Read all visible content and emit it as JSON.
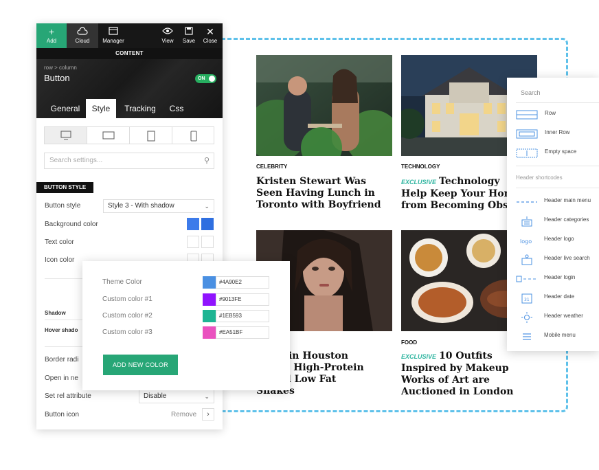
{
  "toolbar": {
    "add": "Add",
    "cloud": "Cloud",
    "manager": "Manager",
    "view": "View",
    "save": "Save",
    "close": "Close"
  },
  "content_label": "CONTENT",
  "element": {
    "breadcrumb": "row > column",
    "name": "Button",
    "toggle": "ON"
  },
  "tabs": [
    "General",
    "Style",
    "Tracking",
    "Css"
  ],
  "search": {
    "placeholder": "Search settings..."
  },
  "button_style": {
    "section_title": "BUTTON STYLE",
    "button_style_label": "Button style",
    "button_style_value": "Style 3 - With shadow",
    "background_color_label": "Background color",
    "text_color_label": "Text color",
    "icon_color_label": "Icon color",
    "shadow_label": "Shadow",
    "hover_shadow_label": "Hover shado",
    "border_radius_label": "Border radi",
    "open_new_label": "Open in ne",
    "rel_label": "Set rel attribute",
    "rel_value": "Disable",
    "icon_label": "Button icon",
    "remove": "Remove"
  },
  "colors": {
    "accent": "#27A676",
    "bg_swatch": "#3D7BEA"
  },
  "color_popup": {
    "items": [
      {
        "label": "Theme Color",
        "hex": "#4A90E2"
      },
      {
        "label": "Custom color #1",
        "hex": "#9013FE"
      },
      {
        "label": "Custom color #2",
        "hex": "#1EB593"
      },
      {
        "label": "Custom color #3",
        "hex": "#EA51BF"
      }
    ],
    "add_button": "ADD NEW COLOR"
  },
  "articles": [
    {
      "category": "CELEBRITY",
      "exclusive": "",
      "lines": [
        "Kristen Stewart Was",
        "Seen Having Lunch in",
        "Toronto with Boyfriend"
      ]
    },
    {
      "category": "TECHNOLOGY",
      "exclusive": "EXCLUSIVE",
      "lines": [
        "Technology",
        "Help Keep Your Hon",
        "from Becoming Obs"
      ]
    },
    {
      "category": "",
      "exclusive": "",
      "lines": [
        "Week in Houston",
        "Blogs; High-Protein",
        "es and Low Fat",
        "Shakes"
      ]
    },
    {
      "category": "FOOD",
      "exclusive": "EXCLUSIVE",
      "lines": [
        "10 Outfits",
        "Inspired by Makeup",
        "Works of Art are",
        "Auctioned in London"
      ]
    }
  ],
  "elements_panel": {
    "search": "Search",
    "basic": [
      {
        "icon": "row-icon",
        "label": "Row"
      },
      {
        "icon": "inner-row-icon",
        "label": "Inner Row"
      },
      {
        "icon": "empty-space-icon",
        "label": "Empty space"
      }
    ],
    "group_title": "Header shortcodes",
    "shortcodes": [
      {
        "icon": "main-menu-icon",
        "label": "Header main menu"
      },
      {
        "icon": "categories-icon",
        "label": "Header categories"
      },
      {
        "icon": "logo-icon",
        "label": "Header logo"
      },
      {
        "icon": "live-search-icon",
        "label": "Header live search"
      },
      {
        "icon": "login-icon",
        "label": "Header login"
      },
      {
        "icon": "date-icon",
        "label": "Header date"
      },
      {
        "icon": "weather-icon",
        "label": "Header weather"
      },
      {
        "icon": "mobile-menu-icon",
        "label": "Mobile menu"
      }
    ]
  }
}
